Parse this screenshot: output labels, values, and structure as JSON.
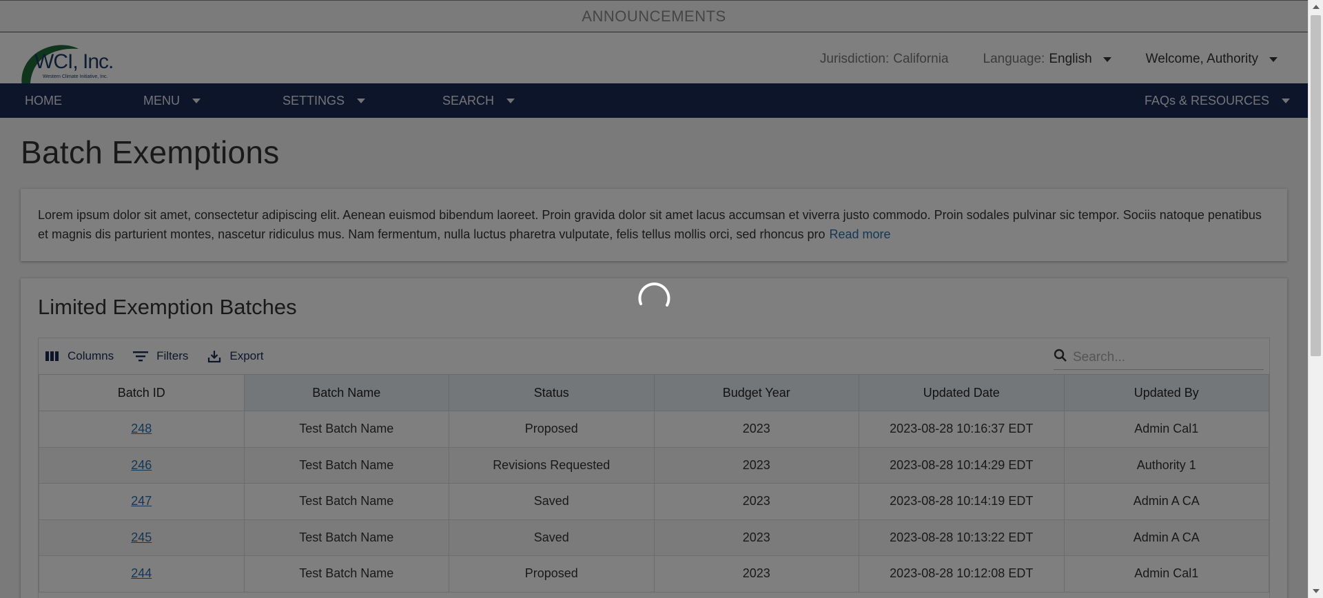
{
  "announcement": "ANNOUNCEMENTS",
  "logo": {
    "name": "WCI, Inc.",
    "subtitle": "Western Climate Initiative, Inc."
  },
  "header": {
    "jurisdiction_label": "Jurisdiction:",
    "jurisdiction_value": "California",
    "language_label": "Language:",
    "language_value": "English",
    "welcome": "Welcome, Authority"
  },
  "nav": {
    "home": "HOME",
    "menu": "MENU",
    "settings": "SETTINGS",
    "search": "SEARCH",
    "faqs": "FAQs & RESOURCES"
  },
  "page_title": "Batch Exemptions",
  "intro": {
    "text": "Lorem ipsum dolor sit amet, consectetur adipiscing elit. Aenean euismod bibendum laoreet. Proin gravida dolor sit amet lacus accumsan et viverra justo commodo. Proin sodales pulvinar sic tempor. Sociis natoque penatibus et magnis dis parturient montes, nascetur ridiculus mus. Nam fermentum, nulla luctus pharetra vulputate, felis tellus mollis orci, sed rhoncus pro",
    "read_more": "Read more"
  },
  "table": {
    "title": "Limited Exemption Batches",
    "toolbar": {
      "columns": "Columns",
      "filters": "Filters",
      "export": "Export"
    },
    "search_placeholder": "Search...",
    "headers": [
      "Batch ID",
      "Batch Name",
      "Status",
      "Budget Year",
      "Updated Date",
      "Updated By"
    ],
    "rows": [
      [
        "248",
        "Test Batch Name",
        "Proposed",
        "2023",
        "2023-08-28 10:16:37 EDT",
        "Admin Cal1"
      ],
      [
        "246",
        "Test Batch Name",
        "Revisions Requested",
        "2023",
        "2023-08-28 10:14:29 EDT",
        "Authority 1"
      ],
      [
        "247",
        "Test Batch Name",
        "Saved",
        "2023",
        "2023-08-28 10:14:19 EDT",
        "Admin A CA"
      ],
      [
        "245",
        "Test Batch Name",
        "Saved",
        "2023",
        "2023-08-28 10:13:22 EDT",
        "Admin A CA"
      ],
      [
        "244",
        "Test Batch Name",
        "Proposed",
        "2023",
        "2023-08-28 10:12:08 EDT",
        "Admin Cal1"
      ]
    ]
  },
  "colors": {
    "nav_bg": "#1b2a56",
    "link": "#2a6ea8",
    "overlay": "rgba(0,0,0,0.5)"
  },
  "icons": [
    "columns-icon",
    "filter-icon",
    "export-icon",
    "search-icon",
    "loading-spinner-icon"
  ]
}
